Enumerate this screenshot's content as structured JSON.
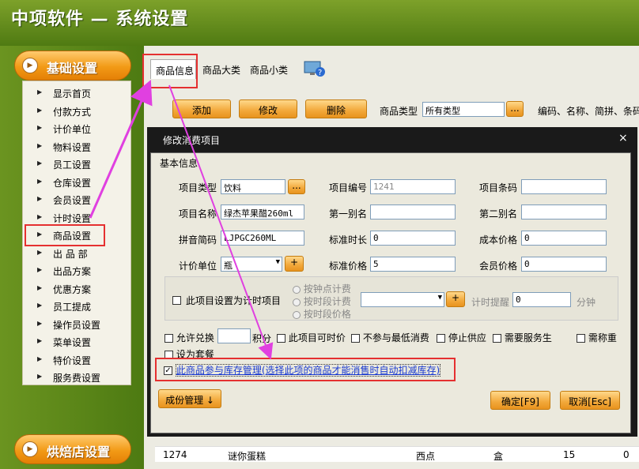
{
  "app_title": "中项软件 — 系统设置",
  "sidebar": {
    "top_category": "基础设置",
    "bottom_category": "烘焙店设置",
    "items": [
      "显示首页",
      "付款方式",
      "计价单位",
      "物料设置",
      "员工设置",
      "仓库设置",
      "会员设置",
      "计时设置",
      "商品设置",
      "出 品 部",
      "出品方案",
      "优惠方案",
      "员工提成",
      "操作员设置",
      "菜单设置",
      "特价设置",
      "服务费设置"
    ]
  },
  "tabs": [
    "商品信息",
    "商品大类",
    "商品小类"
  ],
  "toolbar": {
    "add": "添加",
    "edit": "修改",
    "delete": "删除",
    "type_label": "商品类型",
    "type_value": "所有类型",
    "more": "...",
    "search_hint": "编码、名称、简拼、条码"
  },
  "dialog": {
    "title": "修改消费项目",
    "group": "基本信息",
    "type_label": "项目类型",
    "type_value": "饮料",
    "code_label": "项目编号",
    "code_value": "1241",
    "barcode_label": "项目条码",
    "barcode_value": "",
    "name_label": "项目名称",
    "name_value": "绿杰苹果醋260ml",
    "alias1_label": "第一别名",
    "alias1_value": "",
    "alias2_label": "第二别名",
    "alias2_value": "",
    "pinyin_label": "拼音简码",
    "pinyin_value": "LJPGC260ML",
    "std_time_label": "标准时长",
    "std_time_value": "0",
    "cost_label": "成本价格",
    "cost_value": "0",
    "unit_label": "计价单位",
    "unit_value": "瓶",
    "std_price_label": "标准价格",
    "std_price_value": "5",
    "member_price_label": "会员价格",
    "member_price_value": "0",
    "timed_label": "此项目设置为计时项目",
    "radio1": "按钟点计费",
    "radio2": "按时段计费",
    "radio3": "按时段价格",
    "remind_label": "计时提醒",
    "remind_value": "0",
    "minute_unit": "分钟",
    "allow_exchange": "允许兑换",
    "points_label": "积分",
    "time_disc": "此项目可时价",
    "no_min": "不参与最低消费",
    "stop_supply": "停止供应",
    "need_server": "需要服务生",
    "need_weigh": "需称重",
    "set_package": "设为套餐",
    "stock_label": "此商品参与库存管理(选择此项的商品才能消售时自动扣减库存)",
    "component_btn": "成份管理 ↓",
    "ok_btn": "确定[F9]",
    "cancel_btn": "取消[Esc]",
    "plus": "+",
    "dots": "...",
    "close": "×"
  },
  "grid": [
    {
      "code": "1274",
      "name": "谜你蛋糕",
      "cat": "西点",
      "unit": "盒",
      "qty": "15",
      "val": "0"
    }
  ],
  "colors": {
    "accent_orange": "#f29a16",
    "highlight_red": "#e53030",
    "arrow_magenta": "#e040e0"
  }
}
